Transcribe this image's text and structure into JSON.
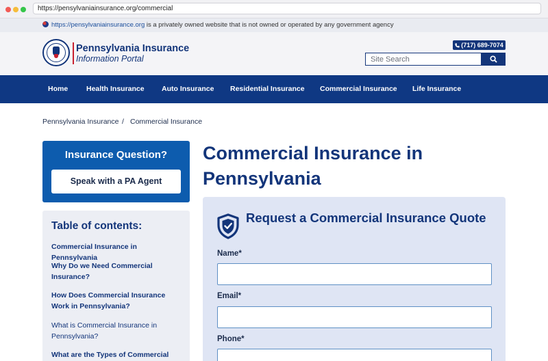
{
  "browser": {
    "url": "https://pensylvaniainsurance.org/commercial"
  },
  "notice": {
    "link_text": "https://pensylvaniainsurance.org",
    "text": " is a privately owned website that is not owned or operated by any government agency"
  },
  "header": {
    "brand_title": "Pennsylvania Insurance",
    "brand_subtitle": "Information Portal",
    "phone": "(717) 689-7074",
    "search_placeholder": "Site Search"
  },
  "nav": {
    "items": [
      {
        "label": "Home"
      },
      {
        "label": "Health Insurance"
      },
      {
        "label": "Auto Insurance"
      },
      {
        "label": "Residential Insurance"
      },
      {
        "label": "Commercial Insurance"
      },
      {
        "label": "Life Insurance"
      }
    ]
  },
  "breadcrumb": {
    "items": [
      "Pennsylvania Insurance",
      "Commercial Insurance"
    ],
    "separator": "/"
  },
  "sidebar": {
    "cta_title": "Insurance Question?",
    "cta_button": "Speak with a PA Agent",
    "toc_title": "Table of contents:",
    "toc_items": [
      {
        "label": "Commercial Insurance in Pennsylvania",
        "bold": true
      },
      {
        "label": "Why Do we Need Commercial Insurance?",
        "bold": true
      },
      {
        "label": "How Does Commercial Insurance Work in Pennsylvania?",
        "bold": true
      },
      {
        "label": "What is Commercial Insurance in Pennsylvania?",
        "bold": false
      },
      {
        "label": "What are the Types of Commercial",
        "bold": true
      }
    ]
  },
  "main": {
    "title": "Commercial Insurance in Pennsylvania",
    "form": {
      "title": "Request a Commercial Insurance Quote",
      "fields": [
        {
          "label": "Name*",
          "value": ""
        },
        {
          "label": "Email*",
          "value": ""
        },
        {
          "label": "Phone*",
          "value": ""
        }
      ]
    }
  },
  "colors": {
    "brand_navy": "#13357a",
    "nav_blue": "#0f3883",
    "cta_blue": "#0d5cae",
    "accent_red": "#c8202f"
  }
}
